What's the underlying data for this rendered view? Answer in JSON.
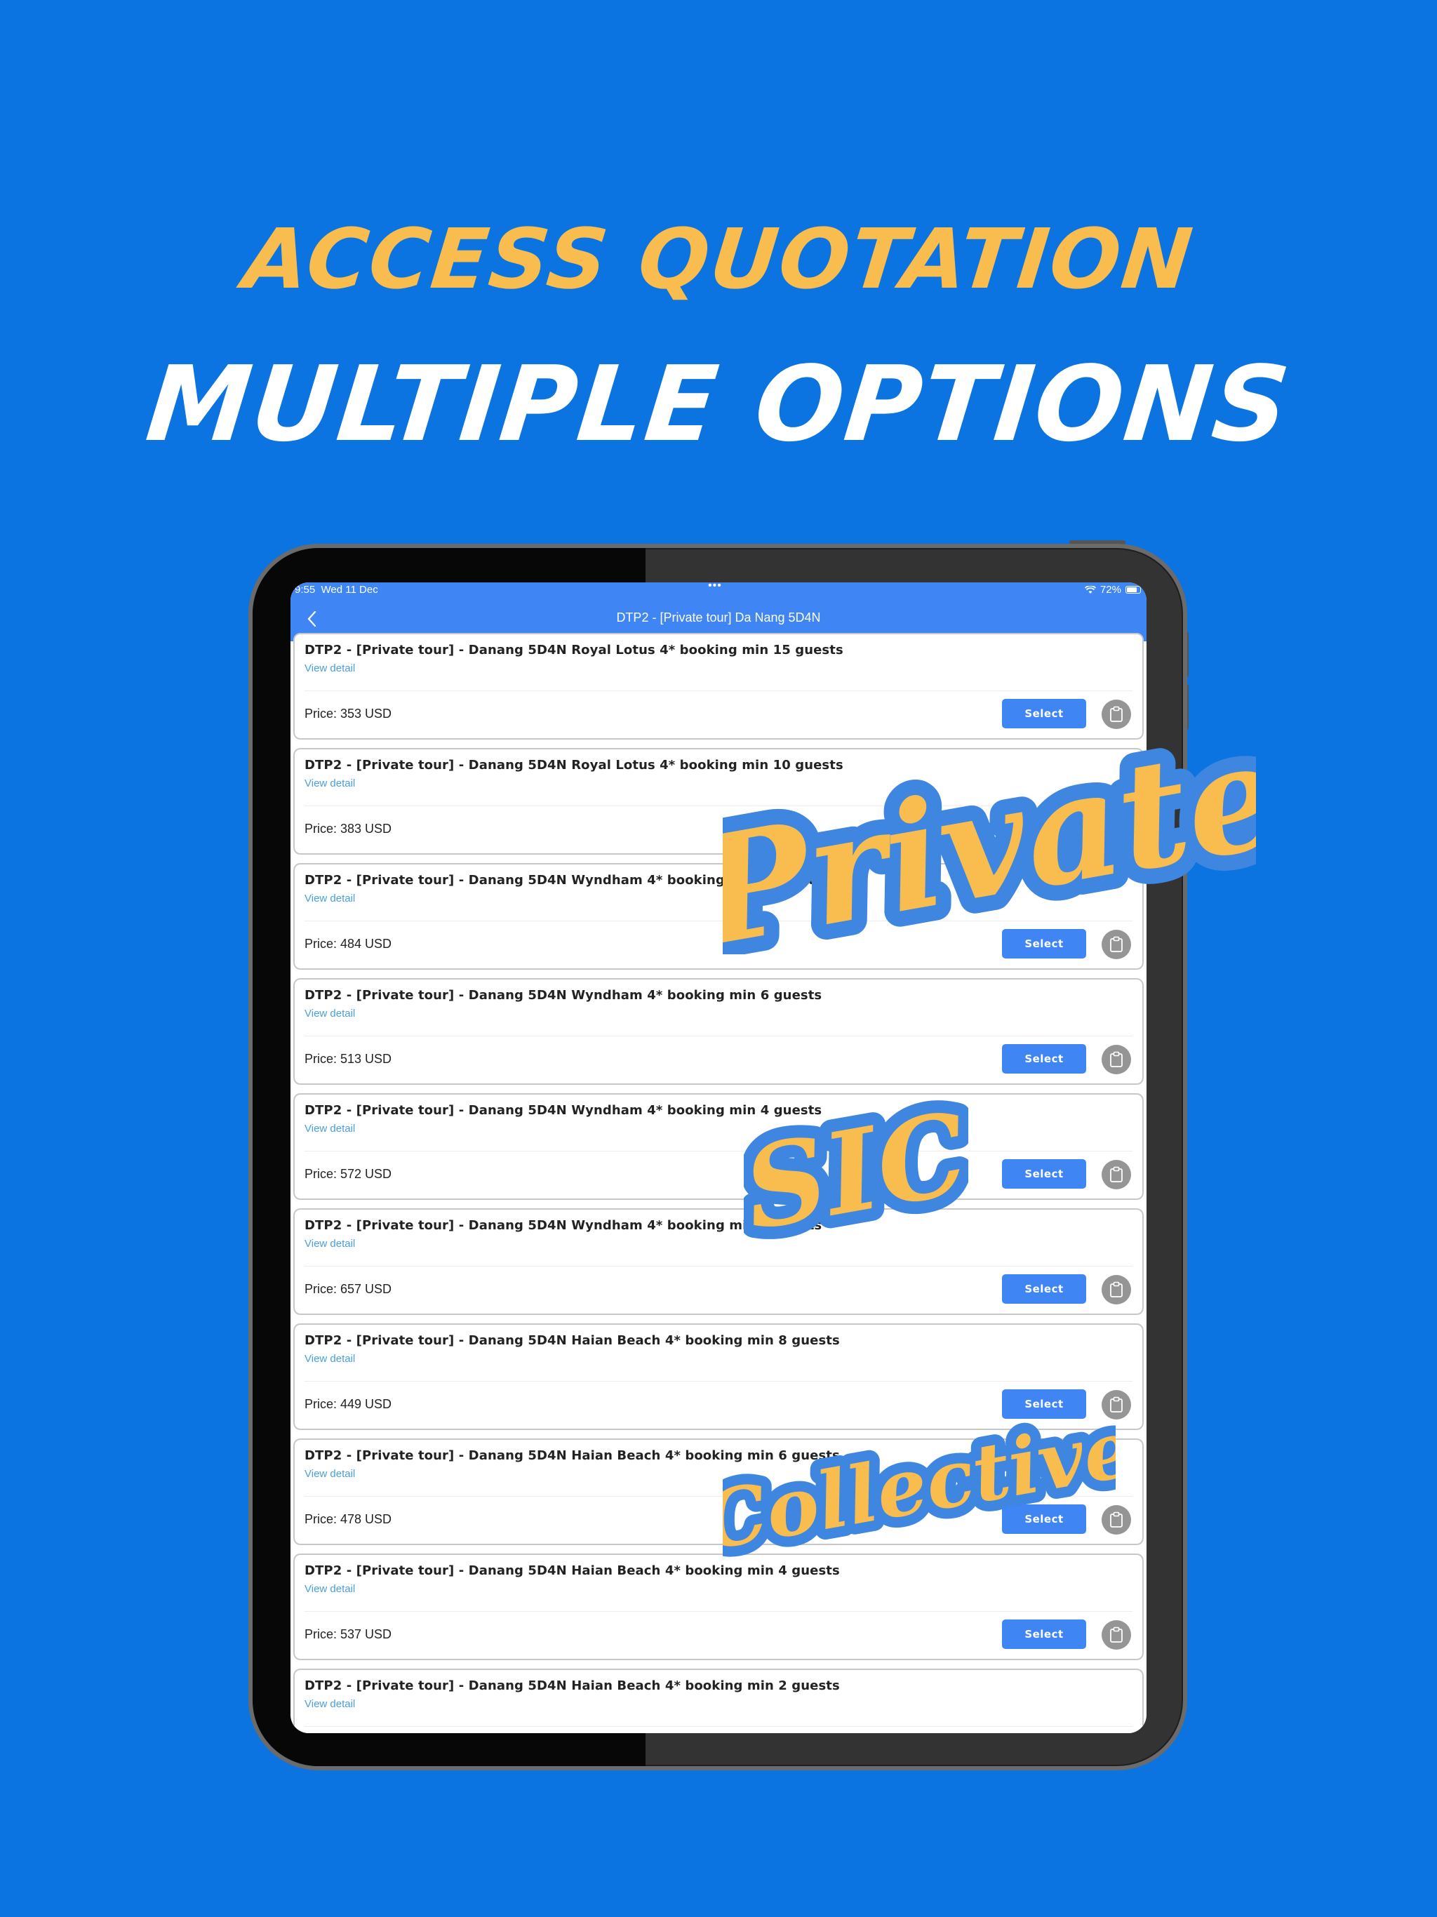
{
  "promo": {
    "headline_top": "ACCESS QUOTATION",
    "headline_bottom": "MULTIPLE OPTIONS",
    "stickers": [
      "Private",
      "SIC",
      "Collective"
    ],
    "colors": {
      "background": "#0b74e0",
      "accent_yellow": "#f8bd4e",
      "sticker_outline": "#3e86e0"
    }
  },
  "status_bar": {
    "time": "9:55",
    "date": "Wed 11 Dec",
    "wifi_icon": "wifi-icon",
    "battery": "72%"
  },
  "nav": {
    "back_icon": "chevron-left-icon",
    "title": "DTP2 - [Private tour] Da Nang 5D4N"
  },
  "list": {
    "view_detail_label": "View detail",
    "select_label": "Select",
    "copy_icon": "clipboard-icon",
    "items": [
      {
        "name": "DTP2 - [Private tour] - Danang 5D4N Royal Lotus 4* booking min 15 guests",
        "price": "Price: 353 USD"
      },
      {
        "name": "DTP2 - [Private tour] - Danang 5D4N Royal Lotus 4* booking min 10 guests",
        "price": "Price: 383 USD"
      },
      {
        "name": "DTP2 - [Private tour] - Danang 5D4N Wyndham 4* booking min 8 guests",
        "price": "Price: 484 USD"
      },
      {
        "name": "DTP2 - [Private tour] - Danang 5D4N Wyndham 4* booking min 6 guests",
        "price": "Price: 513 USD"
      },
      {
        "name": "DTP2 - [Private tour] - Danang 5D4N Wyndham 4* booking min 4 guests",
        "price": "Price: 572 USD"
      },
      {
        "name": "DTP2 - [Private tour] - Danang 5D4N Wyndham 4* booking min 2 guests",
        "price": "Price: 657 USD"
      },
      {
        "name": "DTP2 - [Private tour] - Danang 5D4N Haian Beach 4* booking min 8 guests",
        "price": "Price: 449 USD"
      },
      {
        "name": "DTP2 - [Private tour] - Danang 5D4N Haian Beach 4* booking min 6 guests",
        "price": "Price: 478 USD"
      },
      {
        "name": "DTP2 - [Private tour] - Danang 5D4N Haian Beach 4* booking min 4 guests",
        "price": "Price: 537 USD"
      },
      {
        "name": "DTP2 - [Private tour] - Danang 5D4N Haian Beach 4* booking min 2 guests",
        "price": ""
      }
    ]
  }
}
